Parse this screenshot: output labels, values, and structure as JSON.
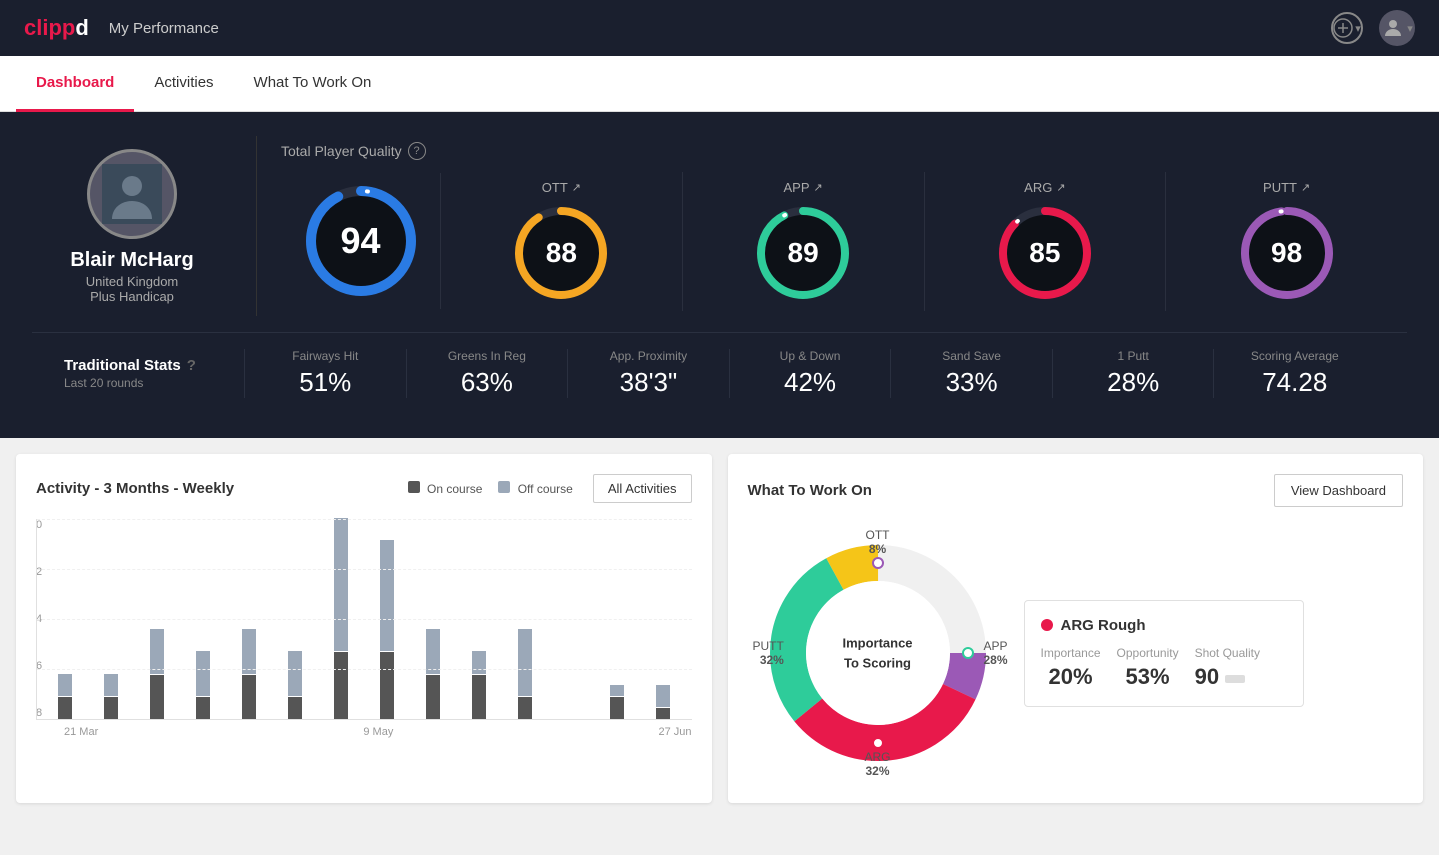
{
  "header": {
    "logo": "clippd",
    "title": "My Performance",
    "add_icon": "⊕",
    "avatar_label": "User Avatar"
  },
  "tabs": [
    {
      "id": "dashboard",
      "label": "Dashboard",
      "active": true
    },
    {
      "id": "activities",
      "label": "Activities",
      "active": false
    },
    {
      "id": "what-to-work-on",
      "label": "What To Work On",
      "active": false
    }
  ],
  "player": {
    "name": "Blair McHarg",
    "country": "United Kingdom",
    "handicap": "Plus Handicap"
  },
  "total_quality": {
    "label": "Total Player Quality",
    "main_score": 94,
    "gauges": [
      {
        "id": "ott",
        "label": "OTT",
        "value": 88,
        "color": "#f5a623",
        "bg": "#2a2f3e"
      },
      {
        "id": "app",
        "label": "APP",
        "value": 89,
        "color": "#2ecc9a",
        "bg": "#2a2f3e"
      },
      {
        "id": "arg",
        "label": "ARG",
        "value": 85,
        "color": "#e8194b",
        "bg": "#2a2f3e"
      },
      {
        "id": "putt",
        "label": "PUTT",
        "value": 98,
        "color": "#9b59b6",
        "bg": "#2a2f3e"
      }
    ]
  },
  "traditional_stats": {
    "label": "Traditional Stats",
    "sublabel": "Last 20 rounds",
    "stats": [
      {
        "name": "Fairways Hit",
        "value": "51%"
      },
      {
        "name": "Greens In Reg",
        "value": "63%"
      },
      {
        "name": "App. Proximity",
        "value": "38'3\""
      },
      {
        "name": "Up & Down",
        "value": "42%"
      },
      {
        "name": "Sand Save",
        "value": "33%"
      },
      {
        "name": "1 Putt",
        "value": "28%"
      },
      {
        "name": "Scoring Average",
        "value": "74.28"
      }
    ]
  },
  "activity_chart": {
    "title": "Activity - 3 Months - Weekly",
    "legend": [
      {
        "label": "On course",
        "color": "#555"
      },
      {
        "label": "Off course",
        "color": "#9ba8b8"
      }
    ],
    "all_activities_btn": "All Activities",
    "y_labels": [
      "0",
      "2",
      "4",
      "6",
      "8"
    ],
    "x_labels": [
      "21 Mar",
      "9 May",
      "27 Jun"
    ],
    "bars": [
      {
        "on": 1,
        "off": 1
      },
      {
        "on": 1,
        "off": 1
      },
      {
        "on": 2,
        "off": 2
      },
      {
        "on": 1,
        "off": 2
      },
      {
        "on": 2,
        "off": 2
      },
      {
        "on": 1,
        "off": 2
      },
      {
        "on": 3,
        "off": 6
      },
      {
        "on": 3,
        "off": 5
      },
      {
        "on": 2,
        "off": 2
      },
      {
        "on": 2,
        "off": 1
      },
      {
        "on": 1,
        "off": 3
      },
      {
        "on": 0,
        "off": 0
      },
      {
        "on": 1,
        "off": 0.5
      },
      {
        "on": 0.5,
        "off": 1
      }
    ]
  },
  "what_to_work_on": {
    "title": "What To Work On",
    "view_dashboard_btn": "View Dashboard",
    "donut_center": "Importance\nTo Scoring",
    "segments": [
      {
        "id": "ott",
        "label": "OTT",
        "percent": "8%",
        "color": "#f5c518",
        "value": 8
      },
      {
        "id": "app",
        "label": "APP",
        "percent": "28%",
        "color": "#2ecc9a",
        "value": 28
      },
      {
        "id": "arg",
        "label": "ARG",
        "percent": "32%",
        "color": "#e8194b",
        "value": 32
      },
      {
        "id": "putt",
        "label": "PUTT",
        "percent": "32%",
        "color": "#9b59b6",
        "value": 32
      }
    ],
    "detail_card": {
      "title": "ARG Rough",
      "dot_color": "#e8194b",
      "metrics": [
        {
          "label": "Importance",
          "value": "20%"
        },
        {
          "label": "Opportunity",
          "value": "53%"
        },
        {
          "label": "Shot Quality",
          "value": "90"
        }
      ]
    }
  },
  "colors": {
    "main_gauge": "#2a7be4",
    "bg_dark": "#1a1f2e",
    "accent_red": "#e8194b"
  }
}
